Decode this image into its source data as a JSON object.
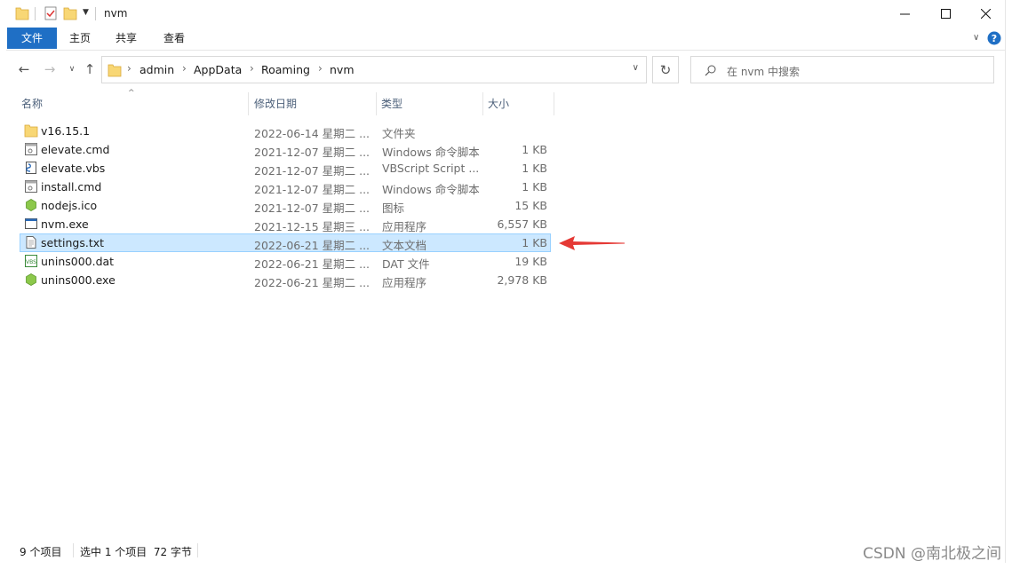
{
  "window": {
    "title": "nvm"
  },
  "ribbon": {
    "tabs": [
      "文件",
      "主页",
      "共享",
      "查看"
    ]
  },
  "address": {
    "crumbs": [
      "admin",
      "AppData",
      "Roaming",
      "nvm"
    ]
  },
  "search": {
    "placeholder": "在 nvm 中搜索"
  },
  "columns": {
    "name": "名称",
    "date": "修改日期",
    "type": "类型",
    "size": "大小"
  },
  "files": [
    {
      "name": "v16.15.1",
      "date": "2022-06-14 星期二 ...",
      "type": "文件夹",
      "size": "",
      "icon": "folder-icon"
    },
    {
      "name": "elevate.cmd",
      "date": "2021-12-07 星期二 ...",
      "type": "Windows 命令脚本",
      "size": "1 KB",
      "icon": "cmd-file-icon"
    },
    {
      "name": "elevate.vbs",
      "date": "2021-12-07 星期二 ...",
      "type": "VBScript Script ...",
      "size": "1 KB",
      "icon": "vbs-file-icon"
    },
    {
      "name": "install.cmd",
      "date": "2021-12-07 星期二 ...",
      "type": "Windows 命令脚本",
      "size": "1 KB",
      "icon": "cmd-file-icon"
    },
    {
      "name": "nodejs.ico",
      "date": "2021-12-07 星期二 ...",
      "type": "图标",
      "size": "15 KB",
      "icon": "nodejs-icon"
    },
    {
      "name": "nvm.exe",
      "date": "2021-12-15 星期三 ...",
      "type": "应用程序",
      "size": "6,557 KB",
      "icon": "exe-file-icon"
    },
    {
      "name": "settings.txt",
      "date": "2022-06-21 星期二 ...",
      "type": "文本文档",
      "size": "1 KB",
      "icon": "txt-file-icon",
      "selected": true
    },
    {
      "name": "unins000.dat",
      "date": "2022-06-21 星期二 ...",
      "type": "DAT 文件",
      "size": "19 KB",
      "icon": "dat-file-icon"
    },
    {
      "name": "unins000.exe",
      "date": "2022-06-21 星期二 ...",
      "type": "应用程序",
      "size": "2,978 KB",
      "icon": "installer-exe-icon"
    }
  ],
  "status": {
    "count": "9 个项目",
    "selection": "选中 1 个项目  72 字节"
  },
  "watermark": "CSDN @南北极之间",
  "colors": {
    "accent": "#1f6fc5",
    "selection_bg": "#cce8ff",
    "selection_border": "#99d1ff",
    "annotation_arrow": "#e53935"
  }
}
